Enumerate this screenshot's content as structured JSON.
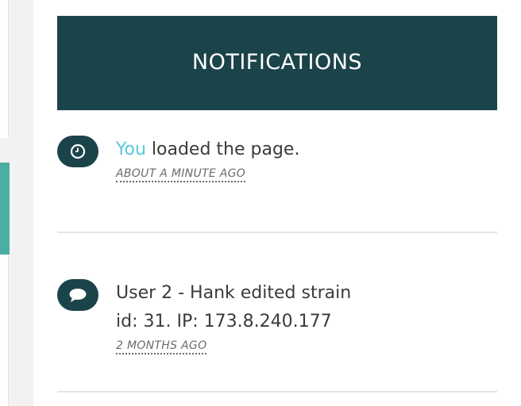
{
  "panel": {
    "title": "NOTIFICATIONS"
  },
  "notifications": [
    {
      "icon": "clock-icon",
      "actor": "You",
      "message": " loaded the page.",
      "time": "ABOUT A MINUTE AGO"
    },
    {
      "icon": "speech-bubble-icon",
      "line1": "User 2 - Hank edited strain",
      "line2": "id: 31. IP: 173.8.240.177",
      "time": "2 MONTHS AGO"
    }
  ],
  "colors": {
    "header_bg": "#1b434a",
    "actor_link": "#57c9de",
    "accent_strip": "#4aaea3"
  }
}
